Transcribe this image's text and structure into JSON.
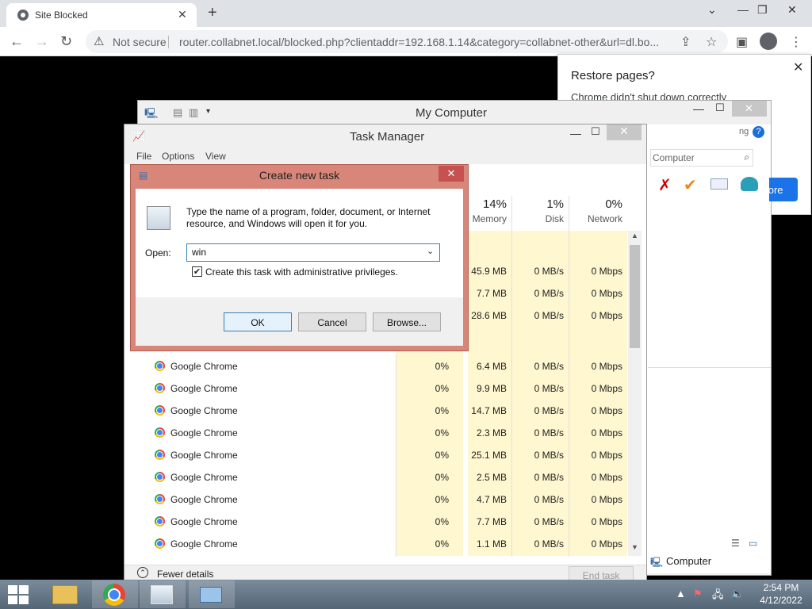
{
  "browser": {
    "tab_title": "Site Blocked",
    "security_label": "Not secure",
    "url": "router.collabnet.local/blocked.php?clientaddr=192.168.1.14&category=collabnet-other&url=dl.bo..."
  },
  "restore_popup": {
    "title": "Restore pages?",
    "message": "Chrome didn't shut down correctly",
    "button_label": "Restore"
  },
  "my_computer": {
    "title": "My Computer",
    "search_placeholder": "Computer",
    "status_text": "Computer",
    "partial_right_text": "ng"
  },
  "task_manager": {
    "title": "Task Manager",
    "menu": [
      "File",
      "Options",
      "View"
    ],
    "columns": [
      {
        "pct": "14%",
        "label": "Memory"
      },
      {
        "pct": "1%",
        "label": "Disk"
      },
      {
        "pct": "0%",
        "label": "Network"
      }
    ],
    "upper_rows": [
      {
        "memory": "45.9 MB",
        "disk": "0 MB/s",
        "network": "0 Mbps"
      },
      {
        "memory": "7.7 MB",
        "disk": "0 MB/s",
        "network": "0 Mbps"
      },
      {
        "memory": "28.6 MB",
        "disk": "0 MB/s",
        "network": "0 Mbps"
      }
    ],
    "rows": [
      {
        "name": "Google Chrome",
        "cpu": "0%",
        "memory": "6.4 MB",
        "disk": "0 MB/s",
        "network": "0 Mbps"
      },
      {
        "name": "Google Chrome",
        "cpu": "0%",
        "memory": "9.9 MB",
        "disk": "0 MB/s",
        "network": "0 Mbps"
      },
      {
        "name": "Google Chrome",
        "cpu": "0%",
        "memory": "14.7 MB",
        "disk": "0 MB/s",
        "network": "0 Mbps"
      },
      {
        "name": "Google Chrome",
        "cpu": "0%",
        "memory": "2.3 MB",
        "disk": "0 MB/s",
        "network": "0 Mbps"
      },
      {
        "name": "Google Chrome",
        "cpu": "0%",
        "memory": "25.1 MB",
        "disk": "0 MB/s",
        "network": "0 Mbps"
      },
      {
        "name": "Google Chrome",
        "cpu": "0%",
        "memory": "2.5 MB",
        "disk": "0 MB/s",
        "network": "0 Mbps"
      },
      {
        "name": "Google Chrome",
        "cpu": "0%",
        "memory": "4.7 MB",
        "disk": "0 MB/s",
        "network": "0 Mbps"
      },
      {
        "name": "Google Chrome",
        "cpu": "0%",
        "memory": "7.7 MB",
        "disk": "0 MB/s",
        "network": "0 Mbps"
      },
      {
        "name": "Google Chrome",
        "cpu": "0%",
        "memory": "1.1 MB",
        "disk": "0 MB/s",
        "network": "0 Mbps"
      }
    ],
    "fewer_details": "Fewer details",
    "end_task": "End task"
  },
  "dialog": {
    "title": "Create new task",
    "description": "Type the name of a program, folder, document, or Internet resource, and Windows will open it for you.",
    "open_label": "Open:",
    "open_value": "win",
    "admin_checkbox_label": "Create this task with administrative privileges.",
    "admin_checked": true,
    "ok": "OK",
    "cancel": "Cancel",
    "browse": "Browse..."
  },
  "taskbar": {
    "time": "2:54 PM",
    "date": "4/12/2022"
  },
  "colors": {
    "dialog_frame": "#d9867a",
    "close_red": "#c75050",
    "highlight_col": "#fff7d0",
    "chrome_blue": "#1a73e8"
  }
}
